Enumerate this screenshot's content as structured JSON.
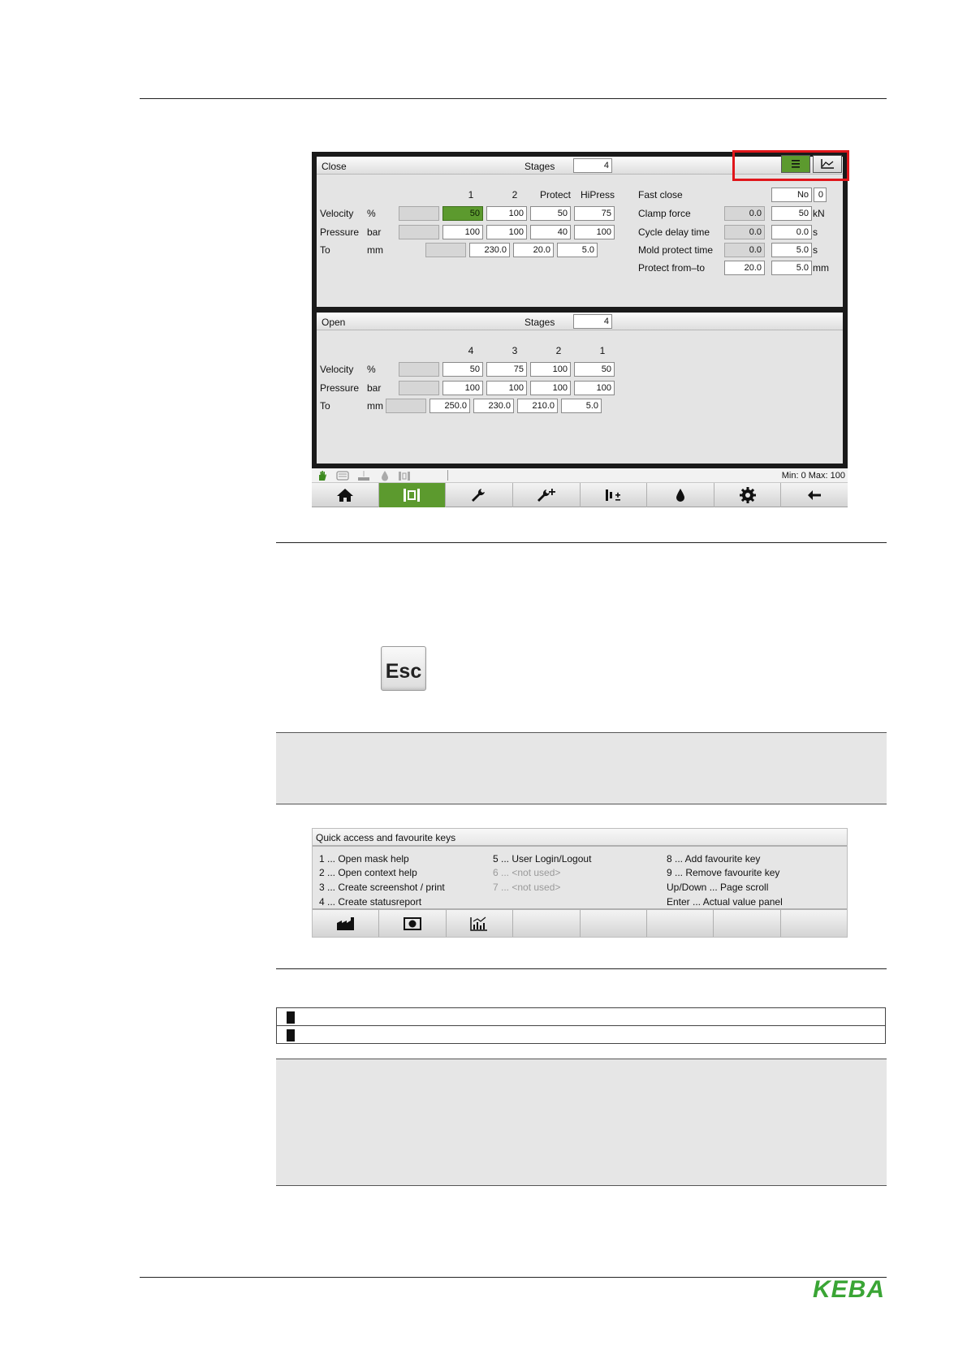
{
  "close": {
    "title": "Close",
    "stages_label": "Stages",
    "stages": "4",
    "columns": [
      "1",
      "2",
      "Protect",
      "HiPress"
    ],
    "velocity_label": "Velocity",
    "velocity_unit": "%",
    "velocity": [
      "50",
      "100",
      "50",
      "75"
    ],
    "pressure_label": "Pressure",
    "pressure_unit": "bar",
    "pressure": [
      "100",
      "100",
      "40",
      "100"
    ],
    "to_label": "To",
    "to_unit": "mm",
    "to": [
      "230.0",
      "20.0",
      "5.0"
    ],
    "fast_close_label": "Fast close",
    "fast_close_value": "No",
    "fast_close_num": "0",
    "clamp_force_label": "Clamp force",
    "clamp_force_actual": "0.0",
    "clamp_force_set": "50",
    "clamp_force_unit": "kN",
    "cycle_delay_label": "Cycle delay time",
    "cycle_delay_actual": "0.0",
    "cycle_delay_set": "0.0",
    "cycle_delay_unit": "s",
    "mold_protect_label": "Mold protect time",
    "mold_protect_actual": "0.0",
    "mold_protect_set": "5.0",
    "mold_protect_unit": "s",
    "protect_from_to_label": "Protect from–to",
    "protect_from": "20.0",
    "protect_to": "5.0",
    "protect_unit": "mm"
  },
  "open": {
    "title": "Open",
    "stages_label": "Stages",
    "stages": "4",
    "columns": [
      "4",
      "3",
      "2",
      "1"
    ],
    "velocity_label": "Velocity",
    "velocity_unit": "%",
    "velocity": [
      "50",
      "75",
      "100",
      "50"
    ],
    "pressure_label": "Pressure",
    "pressure_unit": "bar",
    "pressure": [
      "100",
      "100",
      "100",
      "100"
    ],
    "to_label": "To",
    "to_unit": "mm",
    "to": [
      "250.0",
      "230.0",
      "210.0",
      "5.0"
    ]
  },
  "status": {
    "minmax": "Min:   0 Max: 100"
  },
  "nav_icons": [
    "home-icon",
    "mold-icon",
    "wrench-icon",
    "wrench-plus-icon",
    "injection-icon",
    "drop-icon",
    "gear-icon",
    "back-arrow-icon"
  ],
  "esc_key": {
    "label": "Esc"
  },
  "quick_access": {
    "title": "Quick access and favourite keys",
    "col1": [
      "1 ... Open mask help",
      "2 ... Open context help",
      "3 ... Create screenshot / print",
      "4 ... Create statusreport"
    ],
    "col2": [
      "5 ... User Login/Logout",
      "6 ... <not used>",
      "7 ... <not used>"
    ],
    "col3": [
      "8 ... Add favourite key",
      "9 ... Remove favourite key",
      "Up/Down ... Page scroll",
      "Enter ... Actual value panel"
    ],
    "nav_icons": [
      "factory-icon",
      "screenshot-icon",
      "statusreport-icon"
    ]
  },
  "logo": {
    "text": "KEBA",
    "color": "#3aa535"
  },
  "colors": {
    "accent_green": "#5c9a2e",
    "highlight_red": "#e0161b"
  }
}
